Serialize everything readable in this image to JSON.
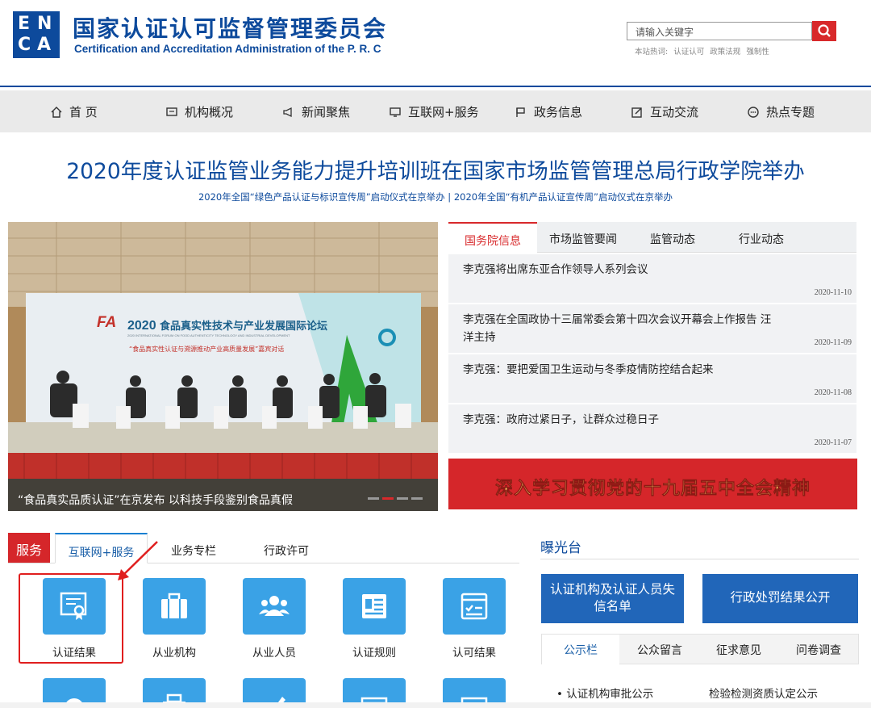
{
  "header": {
    "logo_cn": "国家认证认可监督管理委员会",
    "logo_en": "Certification and Accreditation Administration of the P. R. C",
    "search_placeholder": "请输入关键字",
    "hotwords_label": "本站热词:",
    "hotwords": [
      "认证认可",
      "政策法规",
      "强制性"
    ]
  },
  "nav": [
    {
      "label": "首 页",
      "icon": "home-icon"
    },
    {
      "label": "机构概况",
      "icon": "monitor-icon"
    },
    {
      "label": "新闻聚焦",
      "icon": "megaphone-icon"
    },
    {
      "label": "互联网+服务",
      "icon": "screen-icon"
    },
    {
      "label": "政务信息",
      "icon": "flag-icon"
    },
    {
      "label": "互动交流",
      "icon": "edit-icon"
    },
    {
      "label": "热点专题",
      "icon": "chat-icon"
    }
  ],
  "headline": {
    "title": "2020年度认证监管业务能力提升培训班在国家市场监管管理总局行政学院举办",
    "sub": "2020年全国“绿色产品认证与标识宣传周”启动仪式在京举办 | 2020年全国“有机产品认证宣传周”启动仪式在京举办"
  },
  "slide": {
    "screen_year": "2020",
    "screen_title": "食品真实性技术与产业发展国际论坛",
    "screen_en": "2020 INTERNATIONAL FORUM ON FOOD AUTHENTICITY TECHNOLOGY AND INDUSTRIAL DEVELOPMENT",
    "screen_sub": "“食品真实性认证与溯源推动产业高质量发展”嘉宾对话",
    "caption": "“食品真实品质认证”在京发布 以科技手段鉴别食品真假"
  },
  "news": {
    "tabs": [
      "国务院信息",
      "市场监管要闻",
      "监管动态",
      "行业动态"
    ],
    "active_tab": 0,
    "items": [
      {
        "title": "李克强将出席东亚合作领导人系列会议",
        "date": "2020-11-10"
      },
      {
        "title": "李克强在全国政协十三届常委会第十四次会议开幕会上作报告 汪洋主持",
        "date": "2020-11-09"
      },
      {
        "title": "李克强：要把爱国卫生运动与冬季疫情防控结合起来",
        "date": "2020-11-08"
      },
      {
        "title": "李克强：政府过紧日子，让群众过稳日子",
        "date": "2020-11-07"
      }
    ]
  },
  "banner": {
    "text": "深入学习贯彻党的十九届五中全会精神"
  },
  "service": {
    "label": "服务",
    "tabs": [
      "互联网+服务",
      "业务专栏",
      "行政许可"
    ],
    "tiles": [
      {
        "label": "认证结果",
        "icon": "certificate-icon"
      },
      {
        "label": "从业机构",
        "icon": "briefcase-icon"
      },
      {
        "label": "从业人员",
        "icon": "people-icon"
      },
      {
        "label": "认证规则",
        "icon": "list-icon"
      },
      {
        "label": "认可结果",
        "icon": "checklist-icon"
      }
    ]
  },
  "exposure": {
    "title": "曝光台",
    "buttons": [
      "认证机构及认证人员失信名单",
      "行政处罚结果公开"
    ],
    "tabs": [
      "公示栏",
      "公众留言",
      "征求意见",
      "问卷调查"
    ],
    "items": [
      "认证机构审批公示",
      "检验检测资质认定公示"
    ]
  },
  "colors": {
    "brand_blue": "#0d4a9c",
    "accent_red": "#d8292b",
    "tile_blue": "#3aa2e6"
  }
}
